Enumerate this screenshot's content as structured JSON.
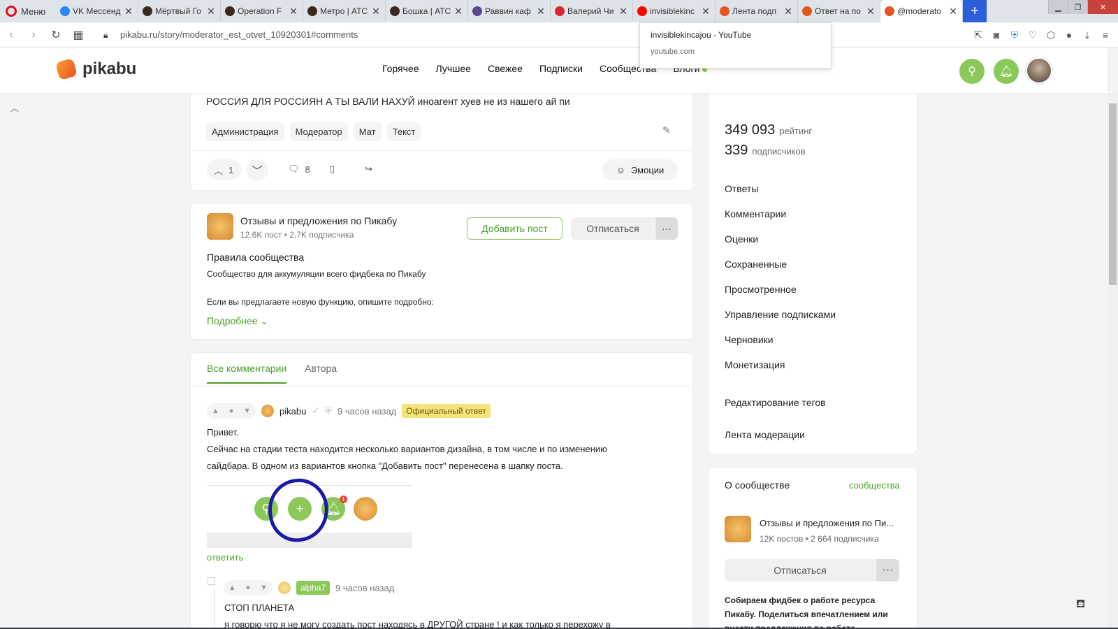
{
  "browser": {
    "menu_label": "Меню",
    "tabs": [
      {
        "title": "VK Мессенд",
        "fav": "#2787f5"
      },
      {
        "title": "Мёртвый Го",
        "fav": "#3a2a1e"
      },
      {
        "title": "Operation F",
        "fav": "#3a2a1e"
      },
      {
        "title": "Метро | АТС",
        "fav": "#3a2a1e"
      },
      {
        "title": "Бошка | АТС",
        "fav": "#3a2a1e"
      },
      {
        "title": "Раввин каф",
        "fav": "#5a4a8c"
      },
      {
        "title": "Валерий Чи",
        "fav": "#d9262c"
      },
      {
        "title": "invisiblekinc",
        "fav": "#ff0000"
      },
      {
        "title": "Лента подп",
        "fav": "#e8541d"
      },
      {
        "title": "Ответ на по",
        "fav": "#e8541d"
      },
      {
        "title": "@moderato",
        "fav": "#e8541d"
      }
    ],
    "url": "pikabu.ru/story/moderator_est_otvet_10920301#comments",
    "tooltip": {
      "title": "invisiblekincajou - YouTube",
      "domain": "youtube.com"
    }
  },
  "header": {
    "logo": "pikabu",
    "nav": [
      "Горячее",
      "Лучшее",
      "Свежее",
      "Подписки",
      "Сообщества",
      "Блоги"
    ]
  },
  "post": {
    "text": "РОССИЯ ДЛЯ РОССИЯН А ТЫ ВАЛИ НАХУЙ иноагент хуев не из нашего ай пи",
    "tags": [
      "Администрация",
      "Модератор",
      "Мат",
      "Текст"
    ],
    "votes": "1",
    "comments_count": "8",
    "emotions_label": "Эмоции"
  },
  "community": {
    "name": "Отзывы и предложения по Пикабу",
    "stats": "12.6K пост • 2.7K подписчика",
    "add_post": "Добавить пост",
    "unsubscribe": "Отписаться",
    "rules_title": "Правила сообщества",
    "rules_desc": "Сообщество для аккумуляции всего фидбека по Пикабу",
    "rules_desc2": "Если вы предлагаете новую функцию, опишите подробно:",
    "more": "Подробнее"
  },
  "comments": {
    "tabs": [
      "Все комментарии",
      "Автора"
    ],
    "items": [
      {
        "user": "pikabu",
        "time": "9 часов назад",
        "badge": "Официальный ответ",
        "lines": [
          "Привет.",
          "Сейчас на стадии теста находится несколько вариантов дизайна, в том числе и по изменению",
          "сайдбара. В одном из вариантов кнопка \"Добавить пост\" перенесена в шапку поста."
        ],
        "image": {
          "notif_count": "1"
        },
        "reply": "ответить"
      },
      {
        "user": "alpha7",
        "time": "9 часов назад",
        "lines": [
          "СТОП ПЛАНЕТА",
          "я говорю что я не могу создать пост находясь в ДРУГОЙ стране ! и как только я перехожу в"
        ]
      }
    ]
  },
  "sidebar": {
    "rating_value": "349 093",
    "rating_label": "рейтинг",
    "subs_value": "339",
    "subs_label": "подписчиков",
    "menu": [
      "Ответы",
      "Комментарии",
      "Оценки",
      "Сохраненные",
      "Просмотренное",
      "Управление подписками",
      "Черновики",
      "Монетизация"
    ],
    "extra": [
      "Редактирование тегов",
      "Лента модерации"
    ],
    "about_title": "О сообществе",
    "about_link": "сообщества",
    "about_name": "Отзывы и предложения по Пи...",
    "about_stats": "12K постов • 2 664 подписчика",
    "about_unsub": "Отписаться",
    "about_desc": "Собираем фидбек о работе ресурса Пикабу. Поделиться впечатлением или внести предложения по работе -"
  },
  "colors": {
    "brand": "#8ac858",
    "accent": "#4c9e2a",
    "scribble": "#1a1aa6"
  }
}
